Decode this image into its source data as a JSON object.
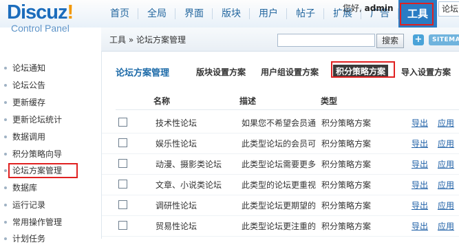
{
  "logo": {
    "main": "Discuz",
    "bang": "!",
    "sub": "Control Panel"
  },
  "nav": {
    "items": [
      "首页",
      "全局",
      "界面",
      "版块",
      "用户",
      "帖子",
      "扩展",
      "广告",
      "工具"
    ],
    "active_index": 8
  },
  "user": {
    "greeting": "您好,",
    "name": "admin"
  },
  "top_search_value": "论坛",
  "breadcrumb": "工具 » 论坛方案管理",
  "search": {
    "value": "",
    "button": "搜索"
  },
  "plus_label": "+",
  "sitemap_label": "SITEMAP",
  "sidebar": {
    "items": [
      "论坛通知",
      "论坛公告",
      "更新缓存",
      "更新论坛统计",
      "数据调用",
      "积分策略向导",
      "论坛方案管理",
      "数据库",
      "运行记录",
      "常用操作管理",
      "计划任务"
    ],
    "active_index": 6
  },
  "main": {
    "title": "论坛方案管理",
    "tabs": [
      "版块设置方案",
      "用户组设置方案",
      "积分策略方案",
      "导入设置方案"
    ],
    "active_tab_index": 2,
    "columns": [
      "名称",
      "描述",
      "类型"
    ],
    "rows": [
      {
        "name": "技术性论坛",
        "desc": "如果您不希望会员通",
        "type": "积分策略方案",
        "export": "导出",
        "apply": "应用"
      },
      {
        "name": "娱乐性论坛",
        "desc": "此类型论坛的会员可",
        "type": "积分策略方案",
        "export": "导出",
        "apply": "应用"
      },
      {
        "name": "动漫、摄影类论坛",
        "desc": "此类型论坛需要更多",
        "type": "积分策略方案",
        "export": "导出",
        "apply": "应用"
      },
      {
        "name": "文章、小说类论坛",
        "desc": "此类型的论坛更重视",
        "type": "积分策略方案",
        "export": "导出",
        "apply": "应用"
      },
      {
        "name": "调研性论坛",
        "desc": "此类型论坛更期望的",
        "type": "积分策略方案",
        "export": "导出",
        "apply": "应用"
      },
      {
        "name": "贸易性论坛",
        "desc": "此类型论坛更注重的",
        "type": "积分策略方案",
        "export": "导出",
        "apply": "应用"
      }
    ]
  },
  "colors": {
    "brand_blue": "#1b6cbc",
    "nav_active": "#2a7cc4",
    "highlight_red": "#e02020",
    "link": "#1d5fa6"
  }
}
